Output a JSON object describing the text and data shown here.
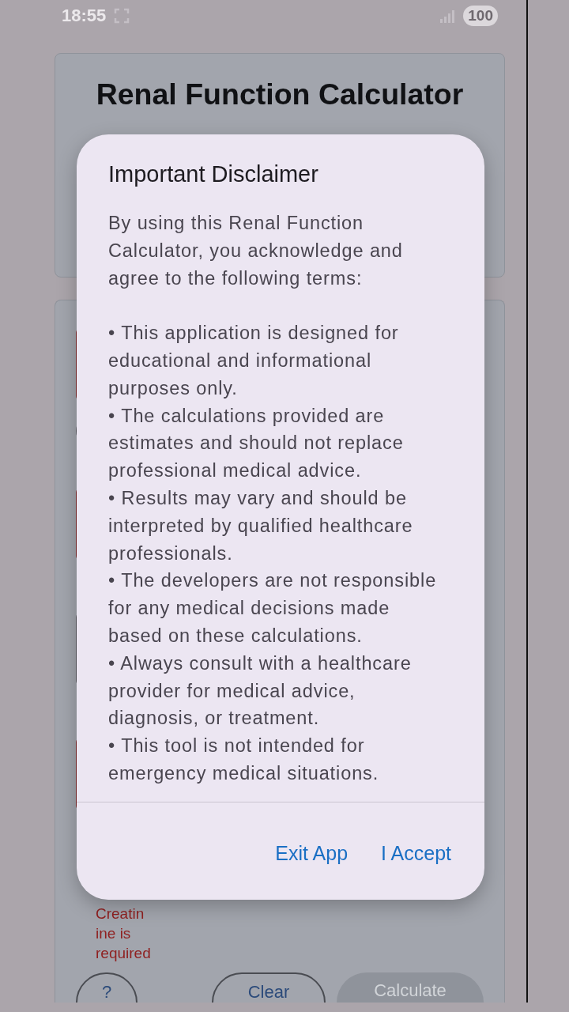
{
  "status_bar": {
    "time": "18:55",
    "battery": "100"
  },
  "header": {
    "title": "Renal Function Calculator"
  },
  "form": {
    "fields": [
      {
        "kind": "error"
      },
      {
        "kind": "pill"
      },
      {
        "kind": "error"
      },
      {
        "kind": "plain"
      },
      {
        "kind": "error"
      }
    ],
    "error_lines": [
      "Creatin",
      "ine is",
      "required"
    ],
    "buttons": [
      {
        "label": "?",
        "kind": "help"
      },
      {
        "label": "Clear",
        "kind": "outlined"
      },
      {
        "label": "Calculate",
        "kind": "filled",
        "disabled": true
      }
    ]
  },
  "dialog": {
    "title": "Important Disclaimer",
    "intro": "By using this Renal Function Calculator, you acknowledge and agree to the following terms:",
    "bullets": [
      "• This application is designed for educational and informational purposes only.",
      "• The calculations provided are estimates and should not replace professional medical advice.",
      "• Results may vary and should be interpreted by qualified healthcare professionals.",
      "• The developers are not responsible for any medical decisions made based on these calculations.",
      "• Always consult with a healthcare provider for medical advice, diagnosis, or treatment.",
      "• This tool is not intended for emergency medical situations."
    ],
    "actions": [
      "Exit App",
      "I Accept"
    ]
  }
}
